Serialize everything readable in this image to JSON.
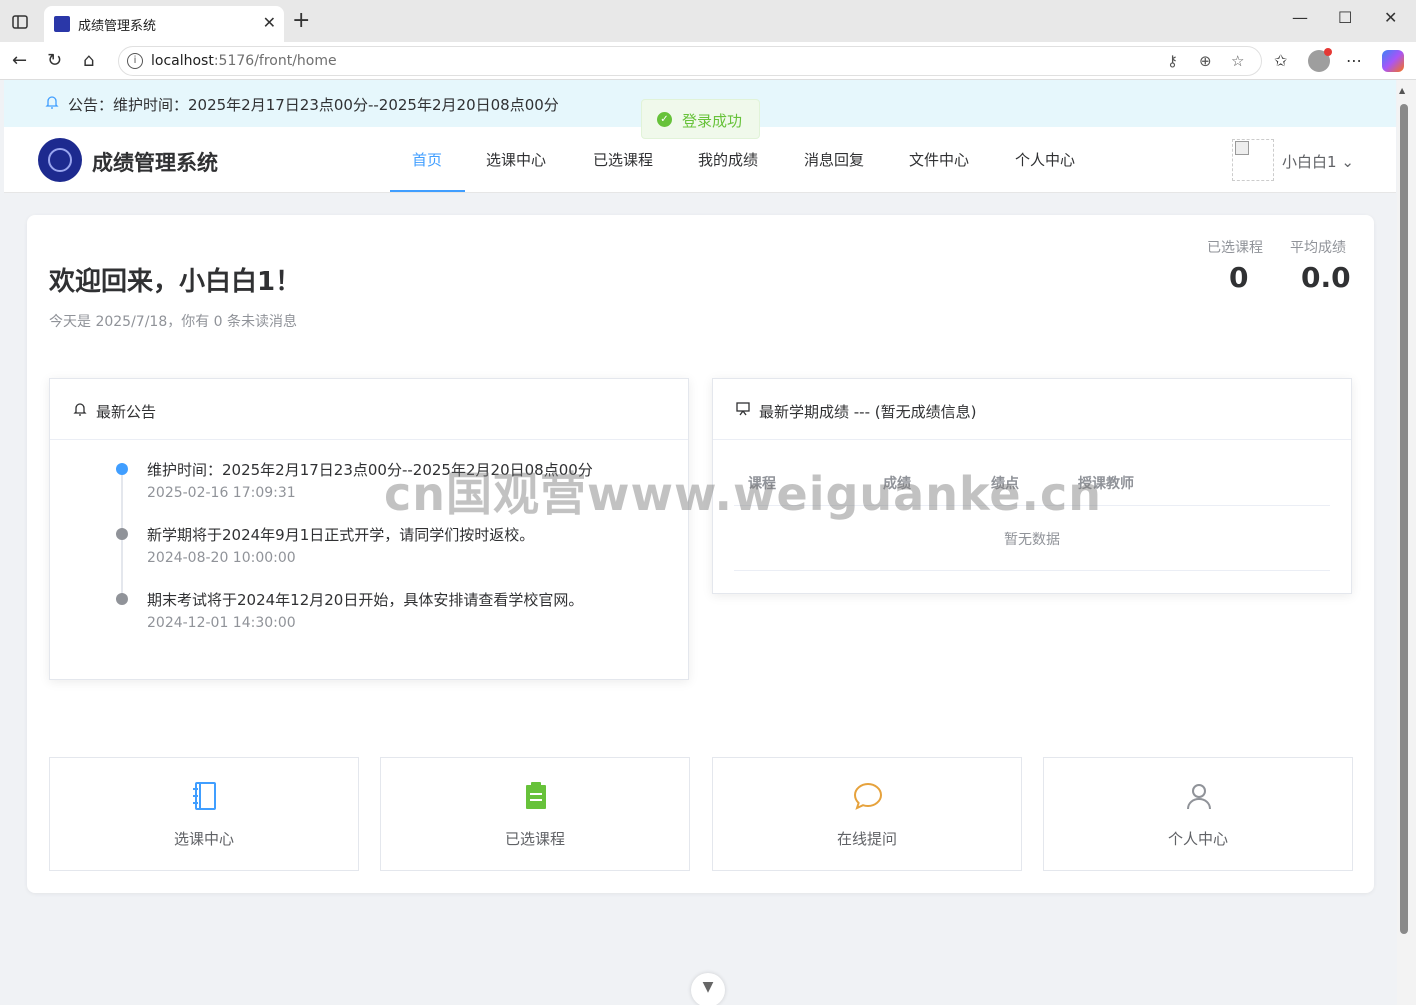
{
  "browser": {
    "tab_title": "成绩管理系统",
    "url_host": "localhost",
    "url_rest": ":5176/front/home"
  },
  "notice": {
    "text": "公告：维护时间：2025年2月17日23点00分--2025年2月20日08点00分"
  },
  "toast": {
    "text": "登录成功"
  },
  "header": {
    "site_title": "成绩管理系统",
    "nav": [
      "首页",
      "选课中心",
      "已选课程",
      "我的成绩",
      "消息回复",
      "文件中心",
      "个人中心"
    ],
    "user_name": "小白白1"
  },
  "welcome": {
    "title": "欢迎回来，小白白1！",
    "subline": "今天是 2025/7/18，你有 0 条未读消息",
    "stats": [
      {
        "label": "已选课程",
        "value": "0"
      },
      {
        "label": "平均成绩",
        "value": "0.0"
      }
    ]
  },
  "announcements": {
    "title": "最新公告",
    "items": [
      {
        "content": "维护时间：2025年2月17日23点00分--2025年2月20日08点00分",
        "time": "2025-02-16 17:09:31"
      },
      {
        "content": "新学期将于2024年9月1日正式开学，请同学们按时返校。",
        "time": "2024-08-20 10:00:00"
      },
      {
        "content": "期末考试将于2024年12月20日开始，具体安排请查看学校官网。",
        "time": "2024-12-01 14:30:00"
      }
    ]
  },
  "grades": {
    "title": "最新学期成绩 --- (暂无成绩信息)",
    "columns": [
      "课程",
      "成绩",
      "绩点",
      "授课教师"
    ],
    "empty_text": "暂无数据"
  },
  "quick_links": [
    {
      "label": "选课中心",
      "icon": "notebook-icon",
      "color": "#409eff"
    },
    {
      "label": "已选课程",
      "icon": "clipboard-icon",
      "color": "#67c23a"
    },
    {
      "label": "在线提问",
      "icon": "chat-bubble-icon",
      "color": "#e6a23c"
    },
    {
      "label": "个人中心",
      "icon": "user-icon",
      "color": "#909399"
    }
  ],
  "watermark": {
    "text": "cn国观营www.weiguanke.cn"
  },
  "colors": {
    "primary": "#409eff",
    "success": "#67c23a",
    "warning": "#e6a23c",
    "info": "#909399",
    "notice_bg": "#e6f7fc"
  }
}
